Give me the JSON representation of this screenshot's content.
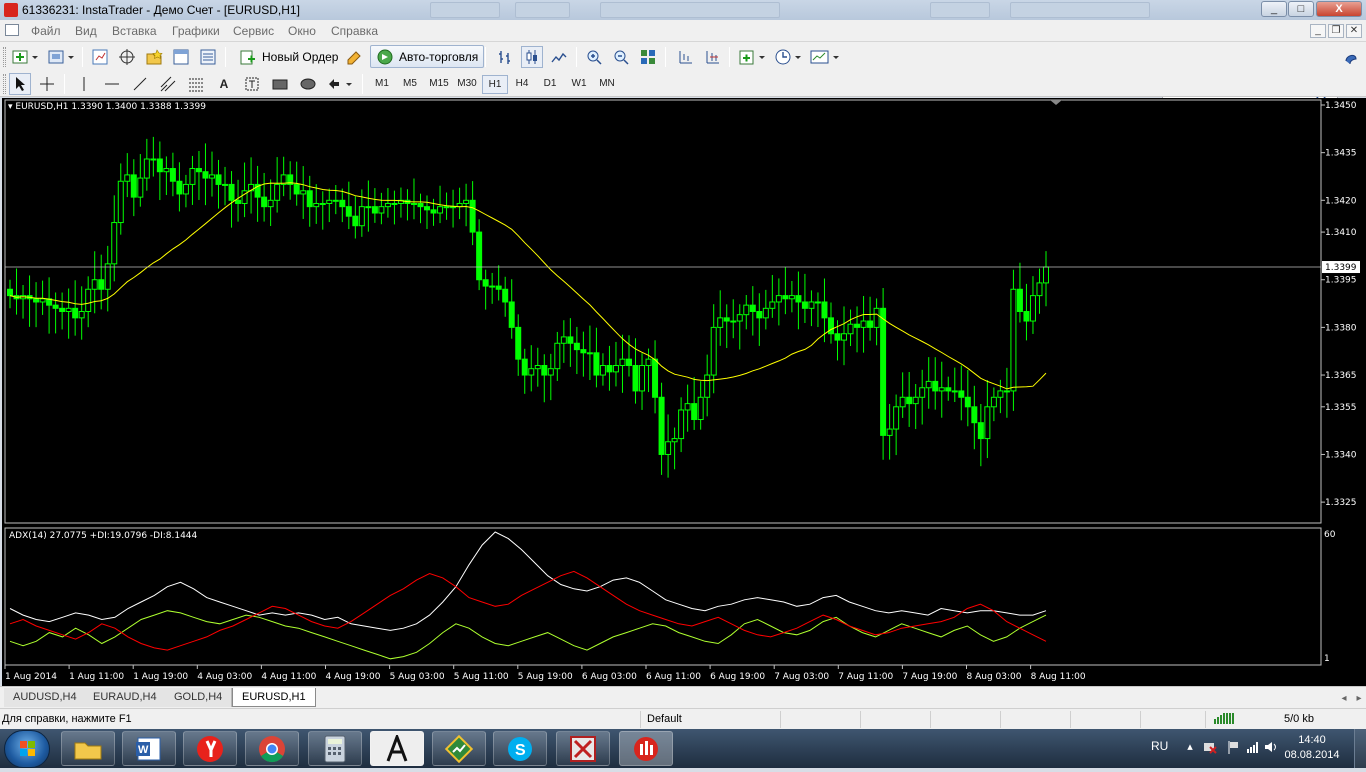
{
  "window": {
    "title": "61336231: InstaTrader - Демо Счет - [EURUSD,H1]",
    "controls": [
      "_",
      "□",
      "X"
    ]
  },
  "menu": {
    "items": [
      "Файл",
      "Вид",
      "Вставка",
      "Графики",
      "Сервис",
      "Окно",
      "Справка"
    ]
  },
  "toolbar": {
    "new_order_label": "Новый Ордер",
    "autotrade_label": "Авто-торговля",
    "search_value": ""
  },
  "timeframes": {
    "items": [
      "M1",
      "M5",
      "M15",
      "M30",
      "H1",
      "H4",
      "D1",
      "W1",
      "MN"
    ],
    "active": "H1"
  },
  "chart": {
    "legend": "EURUSD,H1  1.3390 1.3400 1.3388 1.3399",
    "current_price_label": "1.3399",
    "indicator_legend": "ADX(14) 27.0775 +DI:19.0796 -DI:8.1444",
    "indicator_top_label": "60",
    "indicator_bottom_label": "1",
    "colors": {
      "background": "#000000",
      "candle": "#00ff00",
      "ma": "#ffff00",
      "adx": "#ffffff",
      "plus_di": "#adff2f",
      "minus_di": "#ff0000",
      "grid": "#c0c0c0"
    }
  },
  "chart_data": [
    {
      "type": "candlestick",
      "title": "EURUSD,H1",
      "y_ticks": [
        "1.3450",
        "1.3435",
        "1.3420",
        "1.3410",
        "1.3395",
        "1.3380",
        "1.3365",
        "1.3355",
        "1.3340",
        "1.3325"
      ],
      "ylim": [
        1.332,
        1.345
      ],
      "current_price": 1.3399,
      "x_ticks": [
        "1 Aug 2014",
        "1 Aug 11:00",
        "1 Aug 19:00",
        "4 Aug 03:00",
        "4 Aug 11:00",
        "4 Aug 19:00",
        "5 Aug 03:00",
        "5 Aug 11:00",
        "5 Aug 19:00",
        "6 Aug 03:00",
        "6 Aug 11:00",
        "6 Aug 19:00",
        "7 Aug 03:00",
        "7 Aug 11:00",
        "7 Aug 19:00",
        "8 Aug 03:00",
        "8 Aug 11:00"
      ],
      "close_series": [
        1.339,
        1.3389,
        1.339,
        1.3389,
        1.3388,
        1.3389,
        1.3387,
        1.3386,
        1.3385,
        1.3386,
        1.3383,
        1.3385,
        1.3392,
        1.3395,
        1.3392,
        1.34,
        1.3413,
        1.3426,
        1.3428,
        1.3421,
        1.3427,
        1.3433,
        1.3433,
        1.3429,
        1.343,
        1.3426,
        1.3422,
        1.3425,
        1.343,
        1.3429,
        1.3427,
        1.3428,
        1.3425,
        1.3425,
        1.342,
        1.3419,
        1.3423,
        1.3425,
        1.3421,
        1.3418,
        1.342,
        1.3425,
        1.3428,
        1.3425,
        1.3422,
        1.3423,
        1.3418,
        1.3419,
        1.3419,
        1.342,
        1.342,
        1.3418,
        1.3415,
        1.3412,
        1.3418,
        1.3418,
        1.3416,
        1.3418,
        1.3419,
        1.3419,
        1.342,
        1.3419,
        1.3419,
        1.3418,
        1.3417,
        1.3416,
        1.3418,
        1.3418,
        1.3418,
        1.3419,
        1.342,
        1.341,
        1.3395,
        1.3393,
        1.3393,
        1.3392,
        1.3388,
        1.338,
        1.337,
        1.3365,
        1.3367,
        1.3368,
        1.3365,
        1.3367,
        1.3375,
        1.3377,
        1.3375,
        1.3373,
        1.3372,
        1.3372,
        1.3365,
        1.3368,
        1.3366,
        1.3368,
        1.337,
        1.3368,
        1.336,
        1.3368,
        1.337,
        1.3358,
        1.334,
        1.3344,
        1.3345,
        1.3354,
        1.3356,
        1.3351,
        1.3358,
        1.3365,
        1.338,
        1.3383,
        1.3382,
        1.3382,
        1.3384,
        1.3387,
        1.3385,
        1.3383,
        1.3386,
        1.3388,
        1.339,
        1.3389,
        1.339,
        1.3388,
        1.3386,
        1.3388,
        1.3388,
        1.3383,
        1.3378,
        1.3376,
        1.3378,
        1.3381,
        1.338,
        1.3382,
        1.338,
        1.3386,
        1.3346,
        1.3348,
        1.3355,
        1.3358,
        1.3356,
        1.3358,
        1.3361,
        1.3363,
        1.336,
        1.3361,
        1.336,
        1.336,
        1.3358,
        1.3355,
        1.335,
        1.3345,
        1.3355,
        1.3358,
        1.336,
        1.336,
        1.3392,
        1.3385,
        1.3382,
        1.339,
        1.3394,
        1.3399
      ]
    },
    {
      "type": "line",
      "title": "ADX(14) 27.0775 +DI:19.0796 -DI:8.1444",
      "ylim": [
        1,
        60
      ],
      "series": [
        {
          "name": "ADX",
          "values": [
            25,
            22,
            20,
            19,
            21,
            23,
            22,
            20,
            21,
            25,
            28,
            31,
            35,
            37,
            34,
            30,
            28,
            26,
            24,
            22,
            23,
            22,
            23,
            22,
            20,
            21,
            18,
            17,
            16,
            15,
            16,
            18,
            22,
            28,
            35,
            45,
            54,
            60,
            57,
            52,
            46,
            40,
            36,
            34,
            33,
            35,
            38,
            39,
            37,
            33,
            29,
            27,
            25,
            24,
            26,
            27,
            29,
            30,
            29,
            28,
            26,
            27,
            30,
            31,
            28,
            26,
            24,
            23,
            24,
            23,
            22,
            25,
            24,
            23,
            24,
            24,
            23,
            22,
            22,
            24
          ]
        },
        {
          "name": "+DI",
          "values": [
            10,
            8,
            10,
            14,
            12,
            16,
            13,
            9,
            12,
            16,
            20,
            22,
            24,
            23,
            21,
            19,
            18,
            20,
            22,
            21,
            19,
            17,
            16,
            14,
            12,
            10,
            8,
            6,
            4,
            2,
            3,
            5,
            9,
            14,
            18,
            16,
            12,
            9,
            8,
            10,
            12,
            14,
            11,
            8,
            6,
            9,
            12,
            14,
            16,
            18,
            17,
            14,
            12,
            10,
            9,
            13,
            18,
            20,
            17,
            14,
            13,
            15,
            19,
            21,
            17,
            14,
            12,
            15,
            18,
            16,
            14,
            12,
            15,
            17,
            13,
            10,
            12,
            16,
            19,
            22
          ]
        },
        {
          "name": "-DI",
          "values": [
            18,
            20,
            17,
            15,
            13,
            11,
            14,
            18,
            16,
            12,
            9,
            7,
            6,
            8,
            10,
            12,
            15,
            17,
            20,
            23,
            26,
            25,
            22,
            19,
            17,
            16,
            19,
            23,
            27,
            31,
            34,
            38,
            41,
            39,
            35,
            30,
            28,
            26,
            27,
            31,
            34,
            37,
            40,
            42,
            39,
            35,
            31,
            27,
            24,
            22,
            20,
            18,
            17,
            19,
            21,
            18,
            15,
            13,
            12,
            14,
            16,
            19,
            22,
            20,
            17,
            15,
            13,
            14,
            16,
            17,
            18,
            19,
            21,
            25,
            27,
            24,
            19,
            16,
            13,
            10
          ]
        }
      ]
    }
  ],
  "tabs": {
    "items": [
      "AUDUSD,H4",
      "EURAUD,H4",
      "GOLD,H4",
      "EURUSD,H1"
    ],
    "active": "EURUSD,H1"
  },
  "status": {
    "help": "Для справки, нажмите F1",
    "profile": "Default",
    "traffic": "5/0 kb"
  },
  "taskbar": {
    "lang": "RU",
    "time": "14:40",
    "date": "08.08.2014",
    "apps": [
      "explorer-icon",
      "word-icon",
      "yandex-icon",
      "chrome-icon",
      "calculator-icon",
      "app-a-icon",
      "app-chart-icon",
      "skype-icon",
      "app-red-icon",
      "instatrader-icon"
    ]
  }
}
